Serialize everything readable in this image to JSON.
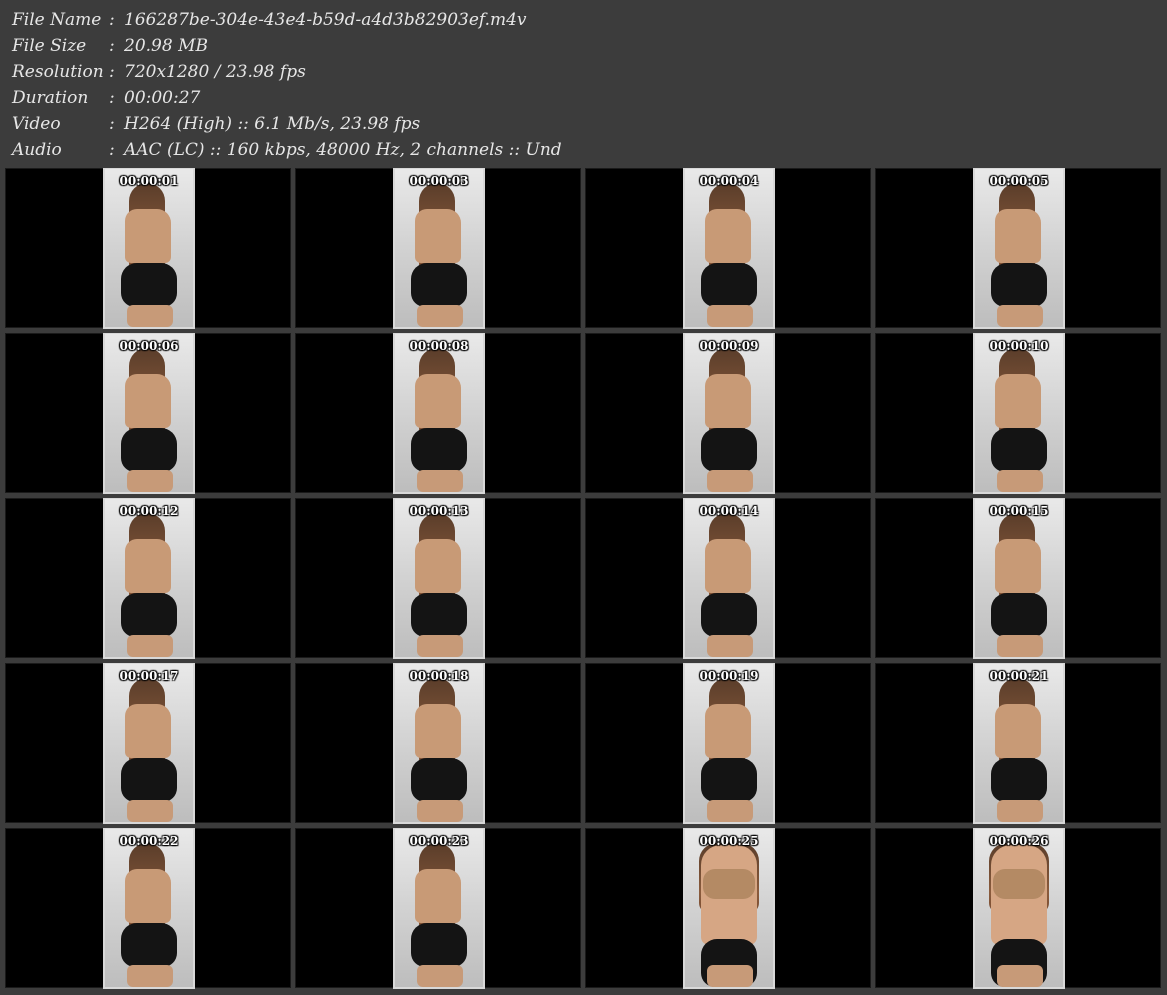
{
  "info": {
    "file_name": {
      "label": "File Name",
      "value": "166287be-304e-43e4-b59d-a4d3b82903ef.m4v"
    },
    "file_size": {
      "label": "File Size",
      "value": "20.98 MB"
    },
    "resolution": {
      "label": "Resolution",
      "value": "720x1280 / 23.98 fps"
    },
    "duration": {
      "label": "Duration",
      "value": "00:00:27"
    },
    "video": {
      "label": "Video",
      "value": "H264 (High) :: 6.1 Mb/s, 23.98 fps"
    },
    "audio": {
      "label": "Audio",
      "value": "AAC (LC) :: 160 kbps, 48000 Hz, 2 channels :: Und"
    },
    "separator": ":"
  },
  "thumbnails": [
    {
      "time": "00:00:01",
      "pose": "back"
    },
    {
      "time": "00:00:03",
      "pose": "back"
    },
    {
      "time": "00:00:04",
      "pose": "back"
    },
    {
      "time": "00:00:05",
      "pose": "back"
    },
    {
      "time": "00:00:06",
      "pose": "back"
    },
    {
      "time": "00:00:08",
      "pose": "back"
    },
    {
      "time": "00:00:09",
      "pose": "back"
    },
    {
      "time": "00:00:10",
      "pose": "back"
    },
    {
      "time": "00:00:12",
      "pose": "back"
    },
    {
      "time": "00:00:13",
      "pose": "back"
    },
    {
      "time": "00:00:14",
      "pose": "back"
    },
    {
      "time": "00:00:15",
      "pose": "back"
    },
    {
      "time": "00:00:17",
      "pose": "back"
    },
    {
      "time": "00:00:18",
      "pose": "back"
    },
    {
      "time": "00:00:19",
      "pose": "back"
    },
    {
      "time": "00:00:21",
      "pose": "back"
    },
    {
      "time": "00:00:22",
      "pose": "back"
    },
    {
      "time": "00:00:23",
      "pose": "back"
    },
    {
      "time": "00:00:25",
      "pose": "front"
    },
    {
      "time": "00:00:26",
      "pose": "front"
    }
  ],
  "colors": {
    "background": "#3c3c3c",
    "cell_background": "#000000",
    "text": "#e6e6e6"
  }
}
